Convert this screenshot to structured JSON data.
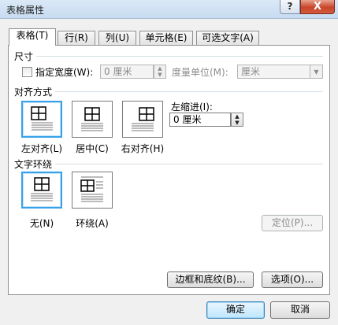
{
  "window": {
    "title": "表格属性",
    "help_label": "?",
    "close_label": "X"
  },
  "tabs": [
    {
      "label": "表格(T)",
      "active": true
    },
    {
      "label": "行(R)"
    },
    {
      "label": "列(U)"
    },
    {
      "label": "单元格(E)"
    },
    {
      "label": "可选文字(A)"
    }
  ],
  "size": {
    "heading": "尺寸",
    "preferred_width_label": "指定宽度(W):",
    "preferred_width_value": "0 厘米",
    "measure_in_label": "度量单位(M):",
    "measure_in_value": "厘米",
    "preferred_width_checked": false
  },
  "alignment": {
    "heading": "对齐方式",
    "options": [
      {
        "label": "左对齐(L)",
        "icon": "table-align-left-icon",
        "selected": true
      },
      {
        "label": "居中(C)",
        "icon": "table-align-center-icon",
        "selected": false
      },
      {
        "label": "右对齐(H)",
        "icon": "table-align-right-icon",
        "selected": false
      }
    ],
    "indent_label": "左缩进(I):",
    "indent_value": "0 厘米"
  },
  "wrapping": {
    "heading": "文字环绕",
    "options": [
      {
        "label": "无(N)",
        "icon": "text-wrap-none-icon",
        "selected": true
      },
      {
        "label": "环绕(A)",
        "icon": "text-wrap-around-icon",
        "selected": false
      }
    ],
    "positioning_label": "定位(P)..."
  },
  "panel_buttons": {
    "borders_label": "边框和底纹(B)...",
    "options_label": "选项(O)..."
  },
  "footer": {
    "ok_label": "确定",
    "cancel_label": "取消"
  }
}
